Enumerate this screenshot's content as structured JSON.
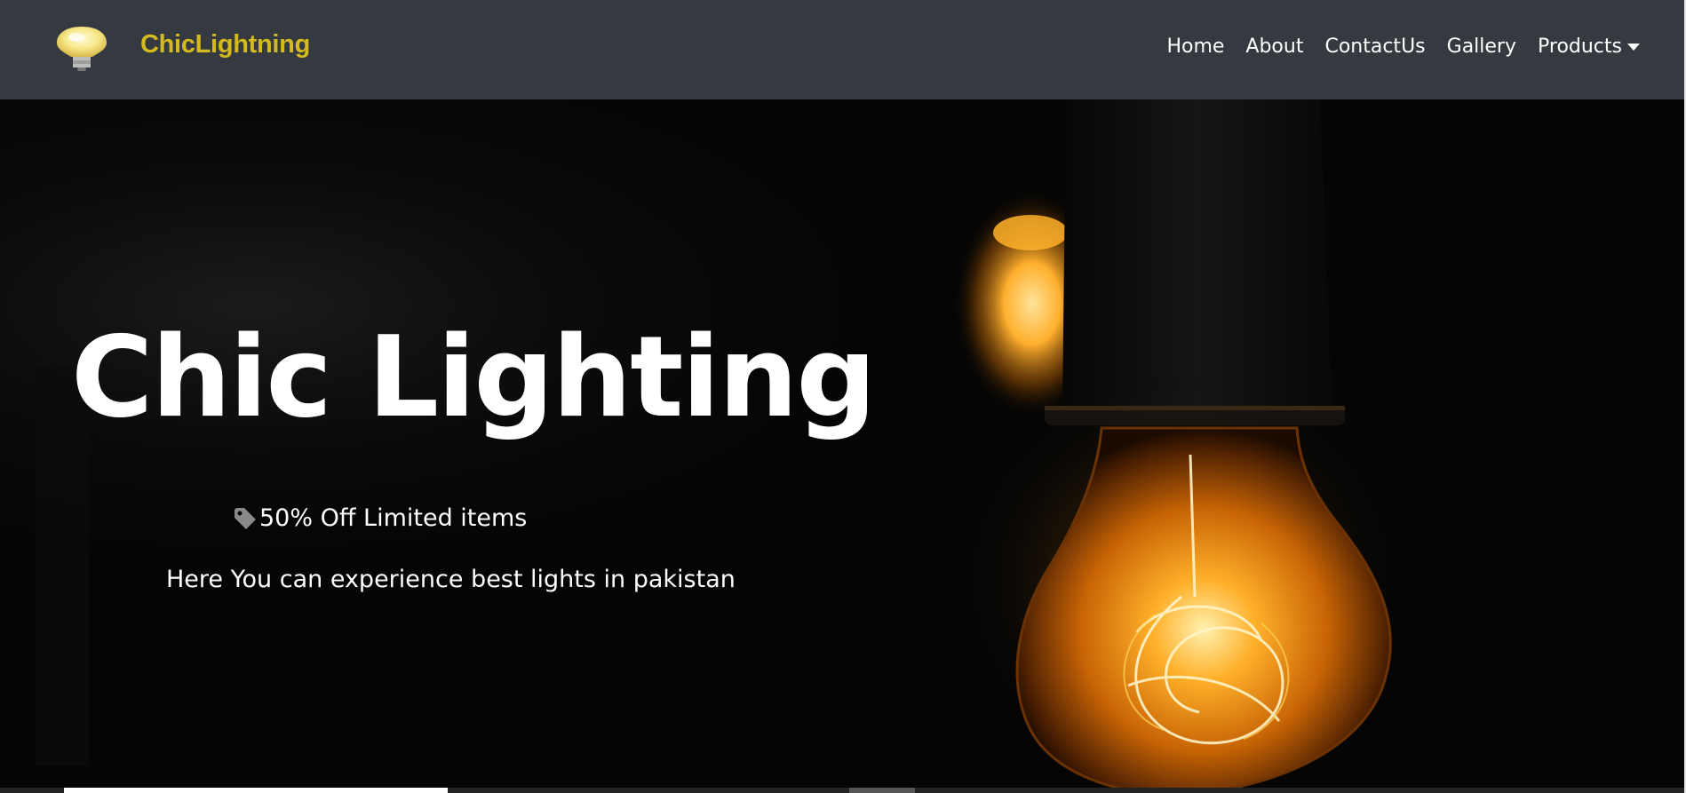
{
  "navbar": {
    "brand": "ChicLightning",
    "links": [
      "Home",
      "About",
      "ContactUs",
      "Gallery"
    ],
    "dropdown_label": "Products",
    "logo_icon": "lightbulb-icon",
    "colors": {
      "background": "#343a40",
      "brand": "#d4b91f",
      "link": "#ffffff"
    }
  },
  "hero": {
    "title": "Chic Lighting",
    "offer_icon": "tag-icon",
    "offer_text": "50% Off Limited items",
    "tagline": "Here You can experience best lights in pakistan",
    "background": "dark photo of glowing Edison filament bulb"
  }
}
